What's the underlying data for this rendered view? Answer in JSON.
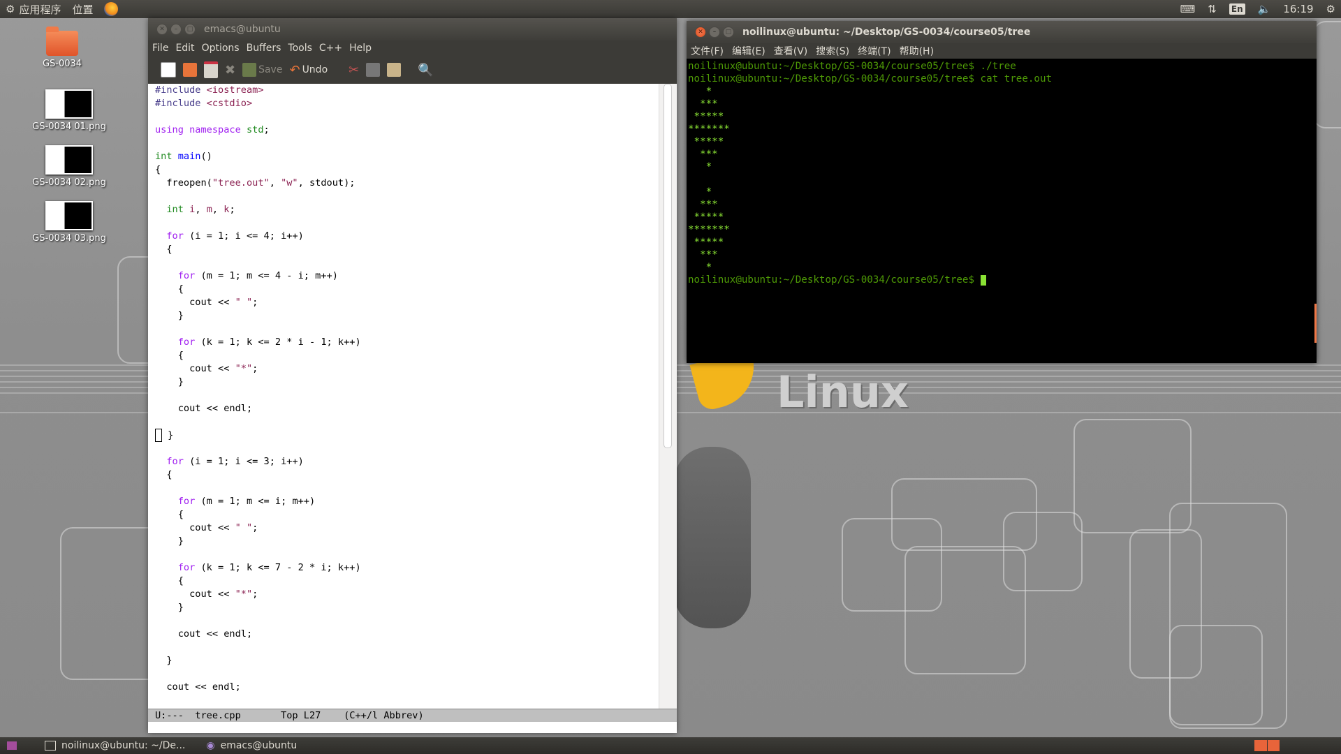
{
  "top_panel": {
    "applications": "应用程序",
    "places": "位置",
    "lang": "En",
    "clock": "16:19"
  },
  "desktop_icons": [
    {
      "label": "GS-0034",
      "kind": "folder"
    },
    {
      "label": "GS-0034 01.png",
      "kind": "image"
    },
    {
      "label": "GS-0034 02.png",
      "kind": "image"
    },
    {
      "label": "GS-0034 03.png",
      "kind": "image"
    }
  ],
  "desktop": {
    "logo_text": "Linux"
  },
  "emacs": {
    "title": "emacs@ubuntu",
    "menu": [
      "File",
      "Edit",
      "Options",
      "Buffers",
      "Tools",
      "C++",
      "Help"
    ],
    "toolbar": {
      "save": "Save",
      "undo": "Undo"
    },
    "modeline": "U:---  tree.cpp       Top L27    (C++/l Abbrev)"
  },
  "terminal": {
    "title": "noilinux@ubuntu: ~/Desktop/GS-0034/course05/tree",
    "menu": [
      "文件(F)",
      "编辑(E)",
      "查看(V)",
      "搜索(S)",
      "终端(T)",
      "帮助(H)"
    ],
    "lines": [
      "noilinux@ubuntu:~/Desktop/GS-0034/course05/tree$ ./tree",
      "noilinux@ubuntu:~/Desktop/GS-0034/course05/tree$ cat tree.out",
      "   *",
      "  ***",
      " *****",
      "*******",
      " *****",
      "  ***",
      "   *",
      "",
      "   *",
      "  ***",
      " *****",
      "*******",
      " *****",
      "  ***",
      "   *",
      "noilinux@ubuntu:~/Desktop/GS-0034/course05/tree$ "
    ]
  },
  "taskbar": {
    "items": [
      "noilinux@ubuntu: ~/De...",
      "emacs@ubuntu"
    ]
  },
  "colors": {
    "accent": "#e8643a",
    "terminal_green": "#4e9a06"
  }
}
